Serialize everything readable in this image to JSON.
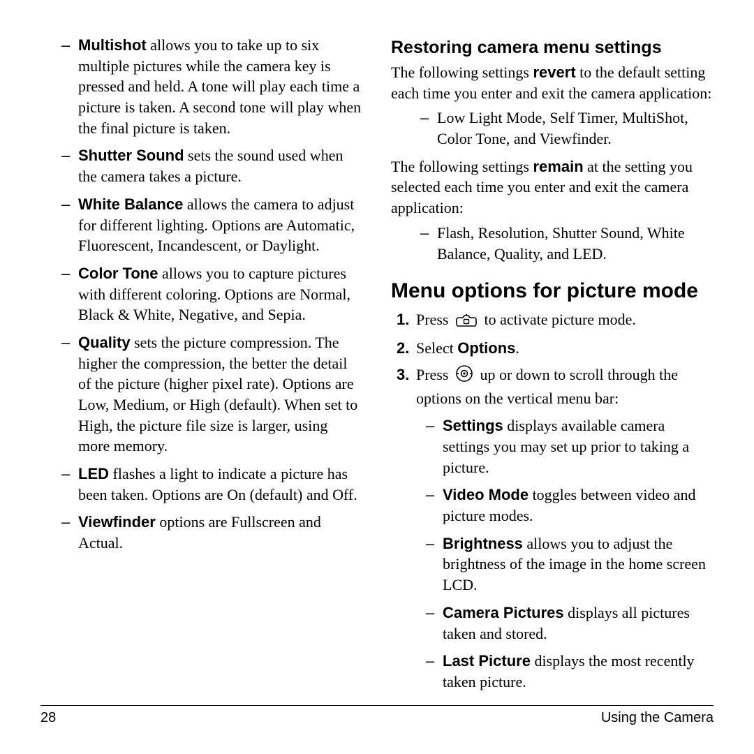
{
  "left": {
    "items": [
      {
        "term": "Multishot",
        "text": " allows you to take up to six multiple pictures while the camera key is pressed and held. A tone will play each time a picture is taken. A second tone will play when the final picture is taken."
      },
      {
        "term": "Shutter Sound",
        "text": " sets the sound used when the camera takes a picture."
      },
      {
        "term": "White Balance",
        "text": " allows the camera to adjust for different lighting. Options are Automatic, Fluorescent, Incandescent, or Daylight."
      },
      {
        "term": "Color Tone",
        "text": " allows you to capture pictures with different coloring. Options are Normal, Black & White, Negative, and Sepia."
      },
      {
        "term": "Quality",
        "text": " sets the picture compression. The higher the compression, the better the detail of the picture (higher pixel rate). Options are Low, Medium, or High (default). When set to High, the picture file size is larger, using more memory."
      },
      {
        "term": "LED",
        "text": " flashes a light to indicate a picture has been taken. Options are On (default) and Off."
      },
      {
        "term": "Viewfinder",
        "text": " options are Fullscreen and Actual."
      }
    ]
  },
  "right": {
    "restoring": {
      "heading": "Restoring camera menu settings",
      "p1a": "The following settings ",
      "p1b": "revert",
      "p1c": " to the default setting each time you enter and exit the camera application:",
      "revert_item": "Low Light Mode, Self Timer, MultiShot, Color Tone, and Viewfinder.",
      "p2a": "The following settings ",
      "p2b": "remain",
      "p2c": " at the setting you selected each time you enter and exit the camera application:",
      "remain_item": "Flash, Resolution, Shutter Sound, White Balance, Quality, and LED."
    },
    "menuopts": {
      "heading": "Menu options for picture mode",
      "step1a": "Press ",
      "step1b": " to activate picture mode.",
      "step2a": "Select ",
      "step2b": "Options",
      "step2c": ".",
      "step3a": "Press ",
      "step3b": " up or down to scroll through the options on the vertical menu bar:",
      "subitems": [
        {
          "term": "Settings",
          "text": " displays available camera settings you may set up prior to taking a picture."
        },
        {
          "term": "Video Mode",
          "text": " toggles between video and picture modes."
        },
        {
          "term": "Brightness",
          "text": " allows you to adjust the brightness of the image in the home screen LCD."
        },
        {
          "term": "Camera Pictures",
          "text": " displays all pictures taken and stored."
        },
        {
          "term": "Last Picture",
          "text": " displays the most recently taken picture."
        }
      ]
    }
  },
  "footer": {
    "page": "28",
    "section": "Using the Camera"
  }
}
